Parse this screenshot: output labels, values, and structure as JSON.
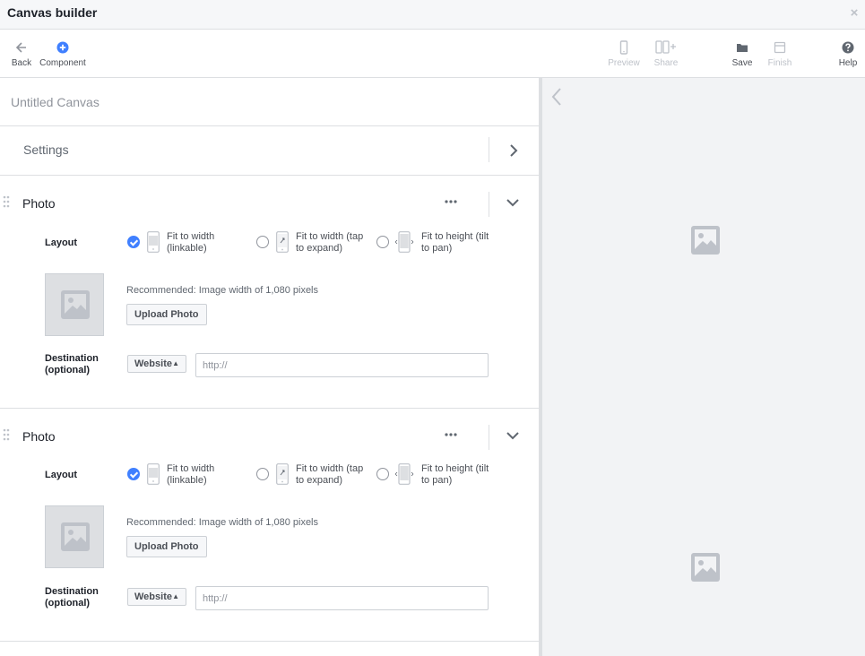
{
  "window": {
    "title": "Canvas builder",
    "close_glyph": "×"
  },
  "toolbar": {
    "back": "Back",
    "component": "Component",
    "preview": "Preview",
    "share": "Share",
    "save": "Save",
    "finish": "Finish",
    "help": "Help"
  },
  "canvas": {
    "name": "Untitled Canvas"
  },
  "settings": {
    "label": "Settings"
  },
  "layout_options": [
    {
      "label_line1": "Fit to width",
      "label_line2": "(linkable)"
    },
    {
      "label_line1": "Fit to width (tap",
      "label_line2": "to expand)"
    },
    {
      "label_line1": "Fit to height (tilt",
      "label_line2": "to pan)"
    }
  ],
  "components": [
    {
      "title": "Photo",
      "layout_label": "Layout",
      "selected_layout": 0,
      "recommendation": "Recommended: Image width of 1,080 pixels",
      "upload_label": "Upload Photo",
      "destination_label_line1": "Destination",
      "destination_label_line2": "(optional)",
      "destination_type": "Website",
      "url_placeholder": "http://"
    },
    {
      "title": "Photo",
      "layout_label": "Layout",
      "selected_layout": 0,
      "recommendation": "Recommended: Image width of 1,080 pixels",
      "upload_label": "Upload Photo",
      "destination_label_line1": "Destination",
      "destination_label_line2": "(optional)",
      "destination_type": "Website",
      "url_placeholder": "http://"
    }
  ],
  "colors": {
    "accent": "#4080ff",
    "border": "#dddfe2",
    "preview_bg": "#f2f3f5",
    "muted": "#90949c"
  },
  "icons": [
    "back-arrow-icon",
    "add-component-icon",
    "phone-preview-icon",
    "share-icon",
    "folder-save-icon",
    "finish-icon",
    "help-icon",
    "close-icon",
    "chevron-right-icon",
    "chevron-down-icon",
    "more-icon",
    "drag-handle-icon",
    "image-placeholder-icon"
  ]
}
